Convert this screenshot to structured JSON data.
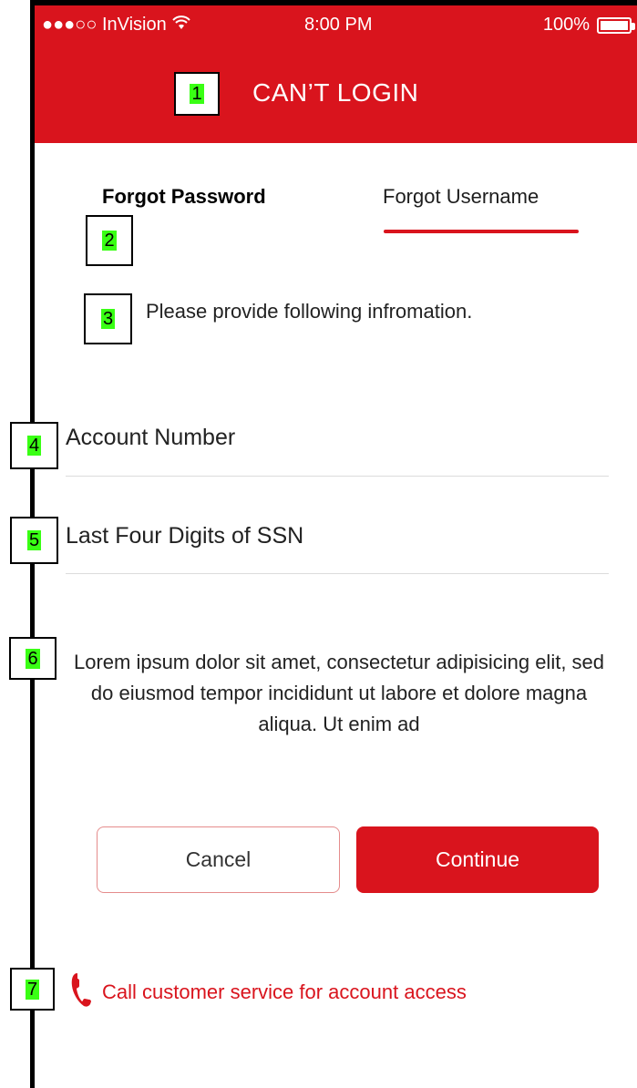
{
  "status_bar": {
    "carrier": "●●●○○ InVision",
    "time": "8:00 PM",
    "battery": "100%"
  },
  "header": {
    "title": "CAN’T LOGIN"
  },
  "tabs": {
    "forgot_password": "Forgot Password",
    "forgot_username": "Forgot Username"
  },
  "instruction": "Please provide following infromation.",
  "fields": {
    "account_number_placeholder": "Account Number",
    "ssn_placeholder": "Last Four Digits of SSN"
  },
  "info_text": "Lorem ipsum dolor sit amet, consectetur adipisicing elit, sed do eiusmod tempor incididunt ut labore et dolore magna aliqua. Ut enim ad",
  "buttons": {
    "cancel": "Cancel",
    "continue": "Continue"
  },
  "call_link": "Call customer service for account access",
  "callouts": [
    "1",
    "2",
    "3",
    "4",
    "5",
    "6",
    "7"
  ],
  "colors": {
    "brand_red": "#d9141d",
    "callout_green": "#39ff14"
  },
  "icons": {
    "wifi": "wifi-icon",
    "battery": "battery-icon",
    "phone": "phone-icon"
  }
}
